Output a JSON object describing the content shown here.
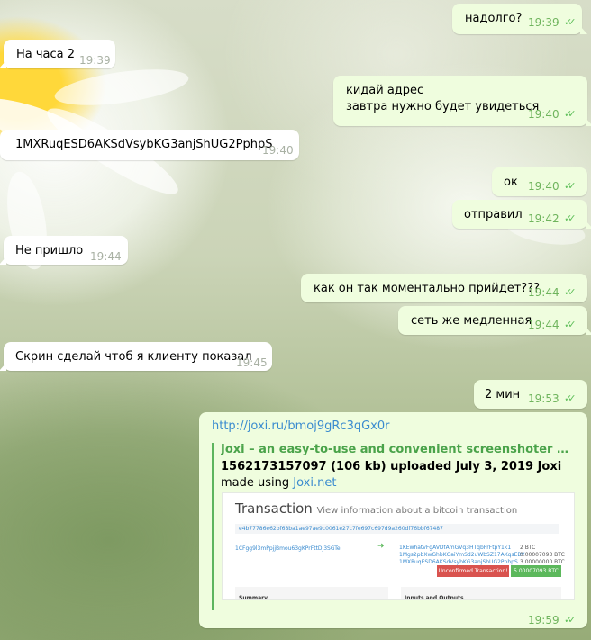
{
  "messages": [
    {
      "text": "надолго?",
      "time": "19:39"
    },
    {
      "text": "На часа 2",
      "time": "19:39"
    },
    {
      "lines": [
        "кидай адрес",
        "завтра нужно будет увидеться"
      ],
      "time": "19:40"
    },
    {
      "text": "1MXRuqESD6AKSdVsybKG3anjShUG2PphpS",
      "time": "19:40"
    },
    {
      "text": "ок",
      "time": "19:40"
    },
    {
      "text": "отправил",
      "time": "19:42"
    },
    {
      "text": "Не пришло",
      "time": "19:44"
    },
    {
      "text": "как он так моментально прийдет???",
      "time": "19:44"
    },
    {
      "text": "сеть же медленная",
      "time": "19:44"
    },
    {
      "text": "Скрин сделай чтоб я клиенту показал",
      "time": "19:45"
    },
    {
      "text": "2 мин",
      "time": "19:53"
    }
  ],
  "link_message": {
    "url": "http://joxi.ru/bmoj9gRc3qGx0r",
    "preview_title": "Joxi – an easy-to-use and convenient screenshoter enabling yo...",
    "preview_line1": "1562173157097 (106 kb) uploaded July 3, 2019 Joxi",
    "preview_line2_prefix": "made using ",
    "preview_line2_link": "Joxi.net",
    "time": "19:59",
    "screenshot": {
      "heading": "Transaction",
      "subheading": "View information about a bitcoin transaction",
      "hash": "e4b77786e62bf68ba1ae97ae9c0061e27c7fe697c697d9a260df76bbf67487",
      "from": "1CFgg9l3mPpjjBmou63gKPrFttDj3SGTe",
      "outputs": [
        {
          "addr": "1KEwhatvFgAVDfAmGVq3HTqbPrFtpY1k1",
          "amount": "2 BTC"
        },
        {
          "addr": "1Mgs2pbXwGhbKGaiYmSd2uWbSZ17AKqsEBV",
          "amount": "0.00007093 BTC"
        },
        {
          "addr": "1MXRuqESD6AKSdVsybKG3anjShUG2PphpS",
          "amount": "3.00000000 BTC"
        }
      ],
      "status_unconfirmed": "Unconfirmed Transaction!",
      "status_total": "5.00007093 BTC",
      "summary_label": "Summary",
      "inputs_outputs_label": "Inputs and Outputs"
    }
  },
  "colors": {
    "incoming_bubble": "#ffffff",
    "outgoing_bubble": "#effdde",
    "read_check": "#5fbf5a",
    "link": "#3a8bcf",
    "preview_accent": "#4aa34a"
  }
}
